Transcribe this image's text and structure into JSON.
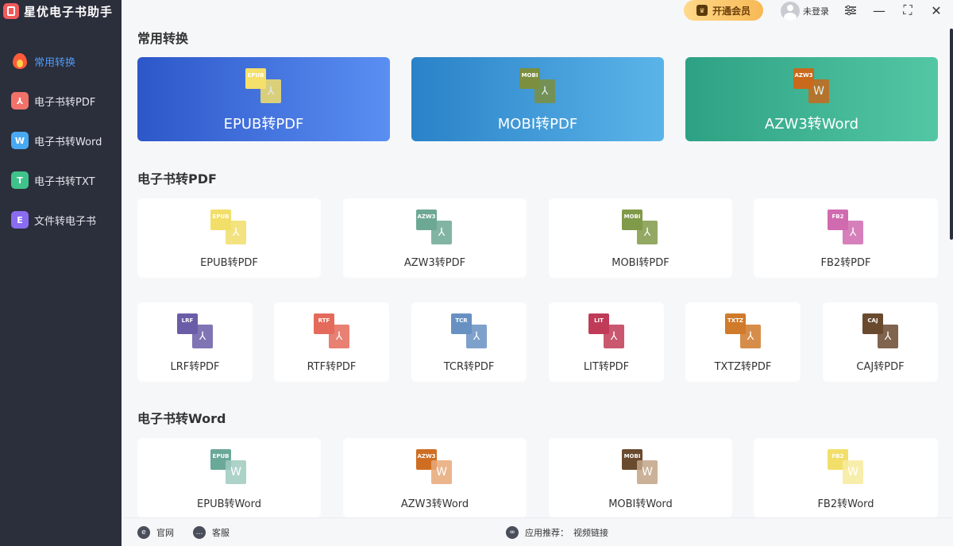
{
  "app": {
    "title": "星优电子书助手"
  },
  "colors": {
    "sidebar_bg": "#2b2e3b",
    "accent": "#4f9bf7",
    "vip": "#f7b955"
  },
  "sidebar": {
    "items": [
      {
        "label": "常用转换",
        "icon": "flame-icon",
        "color": "#ff5b3b",
        "active": true
      },
      {
        "label": "电子书转PDF",
        "icon": "pdf-icon",
        "color": "#f2726a",
        "glyph": "⅄"
      },
      {
        "label": "电子书转Word",
        "icon": "word-icon",
        "color": "#49a8f2",
        "glyph": "W"
      },
      {
        "label": "电子书转TXT",
        "icon": "txt-icon",
        "color": "#3fc38b",
        "glyph": "T"
      },
      {
        "label": "文件转电子书",
        "icon": "ebook-icon",
        "color": "#8a6cf0",
        "glyph": "E"
      }
    ]
  },
  "topbar": {
    "vip_label": "开通会员",
    "login_label": "未登录",
    "settings_icon": "sliders-icon",
    "minimize_glyph": "—",
    "maximize_glyph": "⛶",
    "close_glyph": "✕"
  },
  "sections": {
    "common": "常用转换",
    "to_pdf": "电子书转PDF",
    "to_word": "电子书转Word"
  },
  "hero_cards": [
    {
      "label": "EPUB转PDF",
      "badge": "EPUB",
      "badge_color": "#f4e06a",
      "front_color": "#f4e06a",
      "front_glyph": "⅄",
      "bg": "linear-gradient(90deg,#2d57c9,#5a8ff2)"
    },
    {
      "label": "MOBI转PDF",
      "badge": "MOBI",
      "badge_color": "#7c8f3f",
      "front_color": "#7c8f3f",
      "front_glyph": "⅄",
      "bg": "linear-gradient(90deg,#2a82c8,#5bb4e8)"
    },
    {
      "label": "AZW3转Word",
      "badge": "AZW3",
      "badge_color": "#c9691b",
      "front_color": "#c9691b",
      "front_glyph": "W",
      "bg": "linear-gradient(90deg,#2ea184,#53c7a4)"
    }
  ],
  "pdf_row1": [
    {
      "label": "EPUB转PDF",
      "badge": "EPUB",
      "color": "#f2df6a"
    },
    {
      "label": "AZW3转PDF",
      "badge": "AZW3",
      "color": "#6da895"
    },
    {
      "label": "MOBI转PDF",
      "badge": "MOBI",
      "color": "#7f9a48"
    },
    {
      "label": "FB2转PDF",
      "badge": "FB2",
      "color": "#d06bb0"
    }
  ],
  "pdf_row2": [
    {
      "label": "LRF转PDF",
      "badge": "LRF",
      "color": "#6b5ca7"
    },
    {
      "label": "RTF转PDF",
      "badge": "RTF",
      "color": "#e46b5b"
    },
    {
      "label": "TCR转PDF",
      "badge": "TCR",
      "color": "#6891c2"
    },
    {
      "label": "LIT转PDF",
      "badge": "LIT",
      "color": "#c03b57"
    },
    {
      "label": "TXTZ转PDF",
      "badge": "TXTZ",
      "color": "#d07a2b"
    },
    {
      "label": "CAJ转PDF",
      "badge": "CAJ",
      "color": "#6a4a2e"
    }
  ],
  "word_row": [
    {
      "label": "EPUB转Word",
      "badge": "EPUB",
      "color": "#6aa897"
    },
    {
      "label": "AZW3转Word",
      "badge": "AZW3",
      "color": "#cf6e22"
    },
    {
      "label": "MOBI转Word",
      "badge": "MOBI",
      "color": "#6a4a2e"
    },
    {
      "label": "FB2转Word",
      "badge": "FB2",
      "color": "#f2df6a"
    }
  ],
  "footer": {
    "website": "官网",
    "support": "客服",
    "recommend": "应用推荐：",
    "video_link": "视频链接"
  }
}
